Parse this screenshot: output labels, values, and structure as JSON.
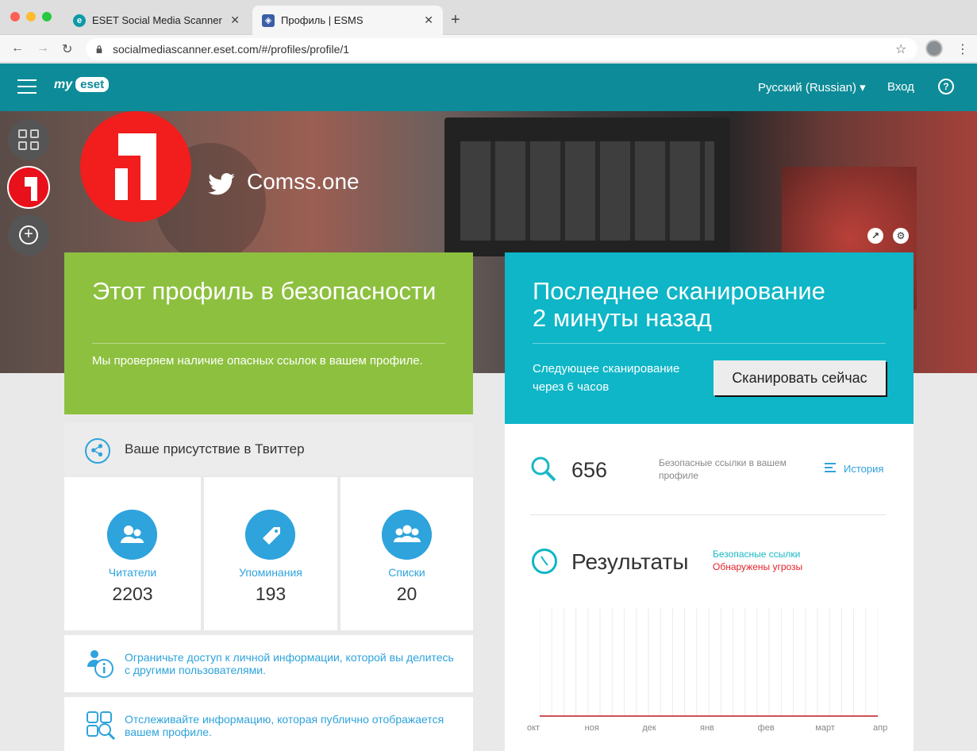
{
  "browser": {
    "tabs": [
      {
        "title": "ESET Social Media Scanner | A",
        "close": "✕",
        "active": false
      },
      {
        "title": "Профиль | ESMS",
        "close": "✕",
        "active": true
      }
    ],
    "new_tab": "+",
    "url": "socialmediascanner.eset.com/#/profiles/profile/1",
    "back": "←",
    "forward": "→",
    "reload": "↻",
    "star": "☆",
    "menu": "⋮"
  },
  "header": {
    "logo_my": "my",
    "logo_eset": "eset",
    "language": "Русский (Russian) ▾",
    "login": "Вход",
    "help": "?"
  },
  "rail": {
    "add": "+"
  },
  "profile": {
    "handle": "Comss.one"
  },
  "safe_card": {
    "title": "Этот профиль в безопасности",
    "text": "Мы проверяем наличие опасных ссылок в вашем профиле."
  },
  "scan_card": {
    "title_line1": "Последнее сканирование",
    "title_line2": "2 минуты назад",
    "next_line1": "Следующее сканирование",
    "next_line2": "через 6 часов",
    "button": "Сканировать сейчас"
  },
  "presence": {
    "label": "Ваше присутствие в Твиттер",
    "stats": [
      {
        "name": "Читатели",
        "value": "2203"
      },
      {
        "name": "Упоминания",
        "value": "193"
      },
      {
        "name": "Списки",
        "value": "20"
      }
    ]
  },
  "tips": [
    {
      "text": "Ограничьте доступ к личной информации, которой вы делитесь с другими пользователями."
    },
    {
      "text": "Отслеживайте информацию, которая публично отображается вашем профиле."
    }
  ],
  "safe_links": {
    "count": "656",
    "label": "Безопасные ссылки в вашем профиле",
    "history": "История"
  },
  "results": {
    "title": "Результаты",
    "legend_safe": "Безопасные ссылки",
    "legend_threat": "Обнаружены угрозы",
    "safe_color": "#19b8c5",
    "threat_color": "#e3242b"
  },
  "chart_data": {
    "type": "line",
    "x": [
      "окт",
      "ноя",
      "дек",
      "янв",
      "фев",
      "март",
      "апр"
    ],
    "series": [
      {
        "name": "Безопасные ссылки",
        "values": [
          0,
          0,
          0,
          0,
          0,
          0,
          0
        ]
      },
      {
        "name": "Обнаружены угрозы",
        "values": [
          0,
          0,
          0,
          0,
          0,
          0,
          0
        ]
      }
    ],
    "title": "Результаты",
    "grid": true
  }
}
